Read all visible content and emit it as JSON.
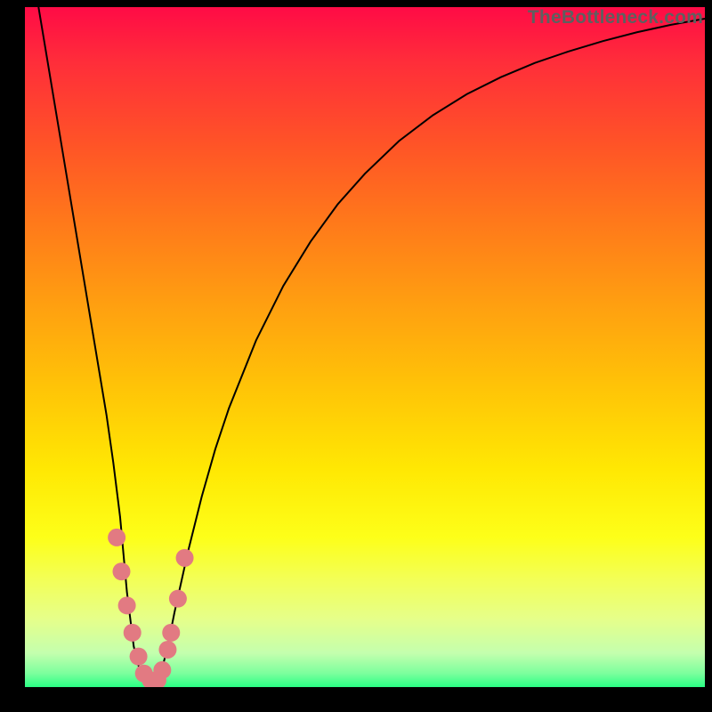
{
  "attribution": "TheBottleneck.com",
  "chart_data": {
    "type": "line",
    "title": "",
    "xlabel": "",
    "ylabel": "",
    "xlim": [
      0,
      100
    ],
    "ylim": [
      0,
      100
    ],
    "series": [
      {
        "name": "curve",
        "x": [
          2,
          3,
          4,
          5,
          6,
          7,
          8,
          9,
          10,
          11,
          12,
          13,
          14,
          15,
          16,
          17,
          18,
          19,
          20,
          21,
          22,
          24,
          26,
          28,
          30,
          34,
          38,
          42,
          46,
          50,
          55,
          60,
          65,
          70,
          75,
          80,
          85,
          90,
          95,
          100
        ],
        "values": [
          100,
          94,
          88,
          82,
          76,
          70,
          64,
          58,
          52,
          46,
          40,
          33,
          25,
          14,
          6,
          2,
          0.5,
          0.5,
          2,
          6,
          11,
          20,
          28,
          35,
          41,
          51,
          59,
          65.5,
          71,
          75.5,
          80.3,
          84.1,
          87.2,
          89.7,
          91.8,
          93.5,
          95,
          96.3,
          97.4,
          98.3
        ]
      },
      {
        "name": "markers",
        "x": [
          13.5,
          14.2,
          15,
          15.8,
          16.7,
          17.5,
          18.5,
          19.5,
          20.2,
          21,
          21.5,
          22.5,
          23.5
        ],
        "values": [
          22,
          17,
          12,
          8,
          4.5,
          2,
          1,
          1,
          2.5,
          5.5,
          8,
          13,
          19
        ]
      }
    ]
  }
}
